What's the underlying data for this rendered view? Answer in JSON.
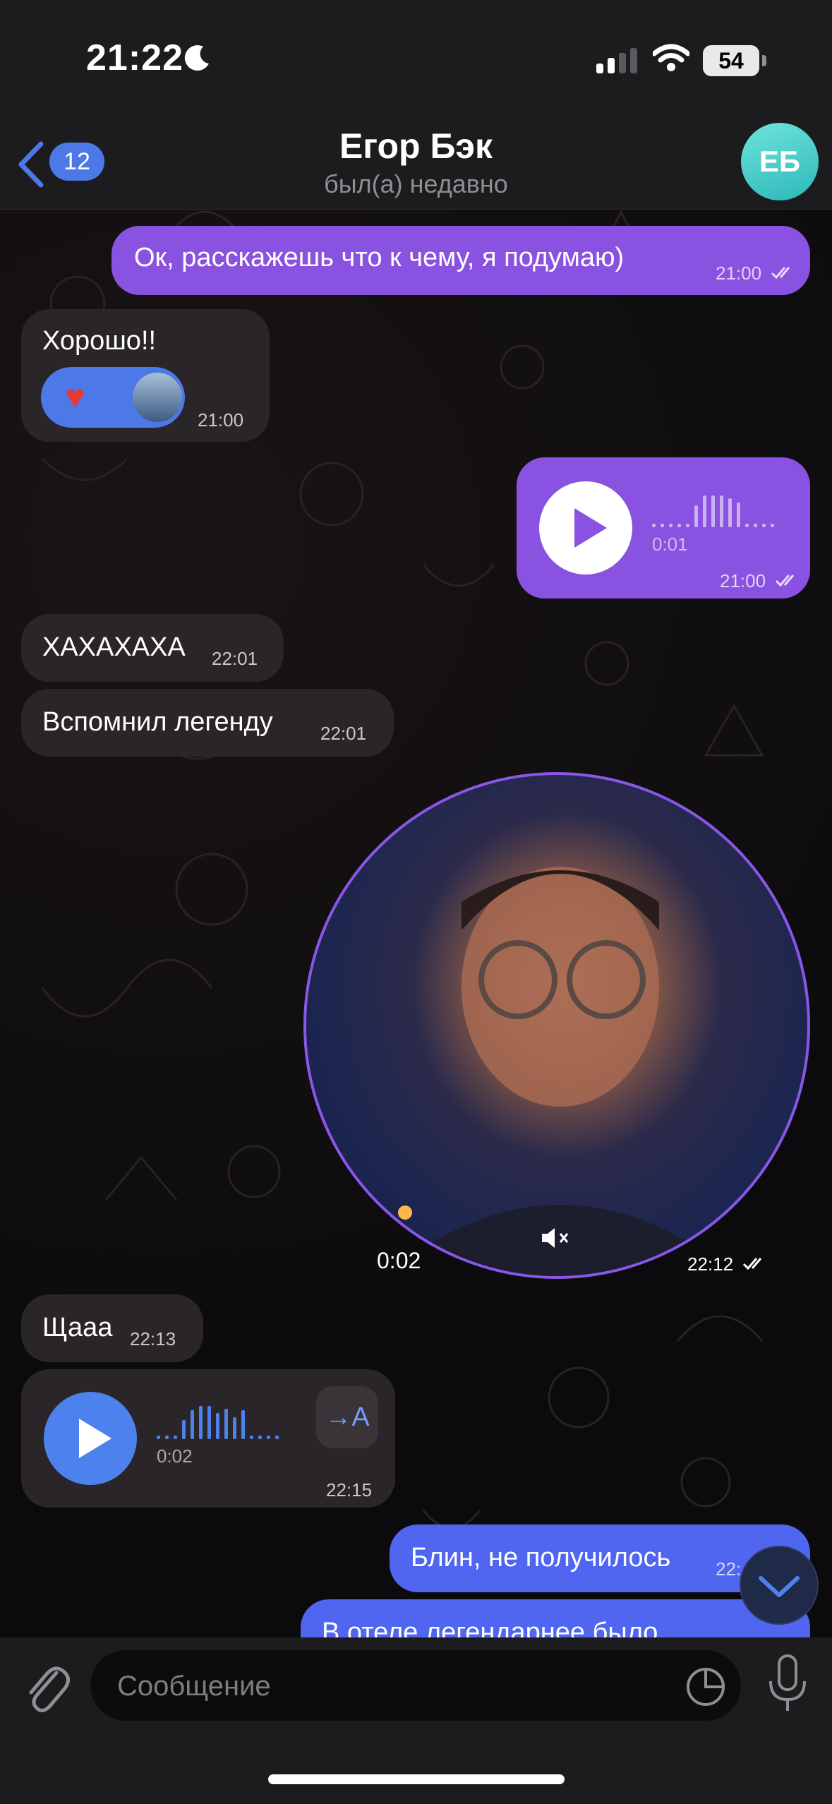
{
  "status": {
    "time": "21:22",
    "battery": "54"
  },
  "header": {
    "back_count": "12",
    "name": "Егор Бэк",
    "status": "был(а) недавно",
    "avatar_initials": "ЕБ"
  },
  "messages": [
    {
      "type": "text",
      "side": "out",
      "text": "Ок, расскажешь что к чему, я подумаю)",
      "time": "21:00",
      "read": true
    },
    {
      "type": "text",
      "side": "in",
      "text": "Хорошо!!",
      "time": "21:00",
      "reaction": "heart"
    },
    {
      "type": "voice",
      "side": "out",
      "duration": "0:01",
      "time": "21:00",
      "read": true
    },
    {
      "type": "text",
      "side": "in",
      "text": "ХАХАХАХА",
      "time": "22:01"
    },
    {
      "type": "text",
      "side": "in",
      "text": "Вспомнил легенду",
      "time": "22:01"
    },
    {
      "type": "video",
      "side": "out",
      "duration": "0:02",
      "time": "22:12",
      "read": true
    },
    {
      "type": "text",
      "side": "in",
      "text": "Щааа",
      "time": "22:13"
    },
    {
      "type": "voice",
      "side": "in",
      "duration": "0:02",
      "time": "22:15",
      "translate": "→A"
    },
    {
      "type": "text",
      "side": "out",
      "text": "Блин, не получилось",
      "time": "22:"
    },
    {
      "type": "text",
      "side": "out",
      "text": "В отеле легендарнее было"
    }
  ],
  "input": {
    "placeholder": "Сообщение"
  },
  "colors": {
    "outgoing": "#8a52e0",
    "outgoing_blue": "#5065f0",
    "incoming": "#2a2528",
    "accent": "#4d79e8"
  }
}
